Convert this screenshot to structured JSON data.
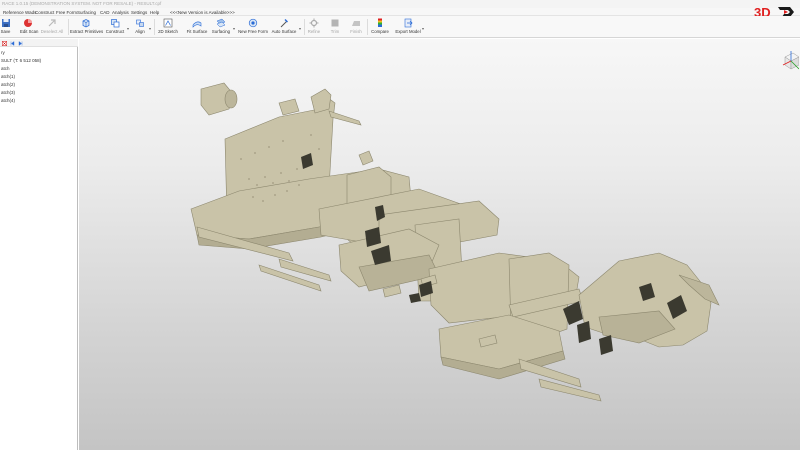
{
  "app": {
    "title": "RACE 1.0.15 (DEMONSTRATION SYSTEM. NOT FOR RESALE) - RESULT.cpf",
    "brand": "3D"
  },
  "menu": {
    "items": [
      "Reference Wads",
      "Construct",
      "Free Form",
      "Surfacing",
      "CAD",
      "Analysis",
      "Settings",
      "Help"
    ],
    "update_notice": "<<<New Version is Available>>>"
  },
  "toolbar": {
    "save": "Save",
    "edit_scan": "Edit Scan",
    "deselect_all": "Deselect All",
    "extract_primitives": "Extract Primitives",
    "construct": "Construct",
    "align": "Align",
    "sketch_2d": "2D Sketch",
    "fit_surface": "Fit Surface",
    "surfacing": "Surfacing",
    "new_free_form": "New Free Form",
    "auto_surface": "Auto Surface",
    "refine": "Refine",
    "trim": "Trim",
    "finish": "Finish",
    "compare": "Compare",
    "export_model": "Export Model"
  },
  "tree": {
    "rows": [
      "ry",
      "SULT (T: 6 512 058)",
      "atch",
      "atch(1)",
      "atch(2)",
      "atch(3)",
      "atch(4)"
    ]
  },
  "colors": {
    "scan": "#c9c3a8",
    "scan_shadow": "#8c876e",
    "scan_dark": "#3b3a30",
    "brand_red": "#e02020",
    "accent_blue": "#2a6bd6"
  }
}
